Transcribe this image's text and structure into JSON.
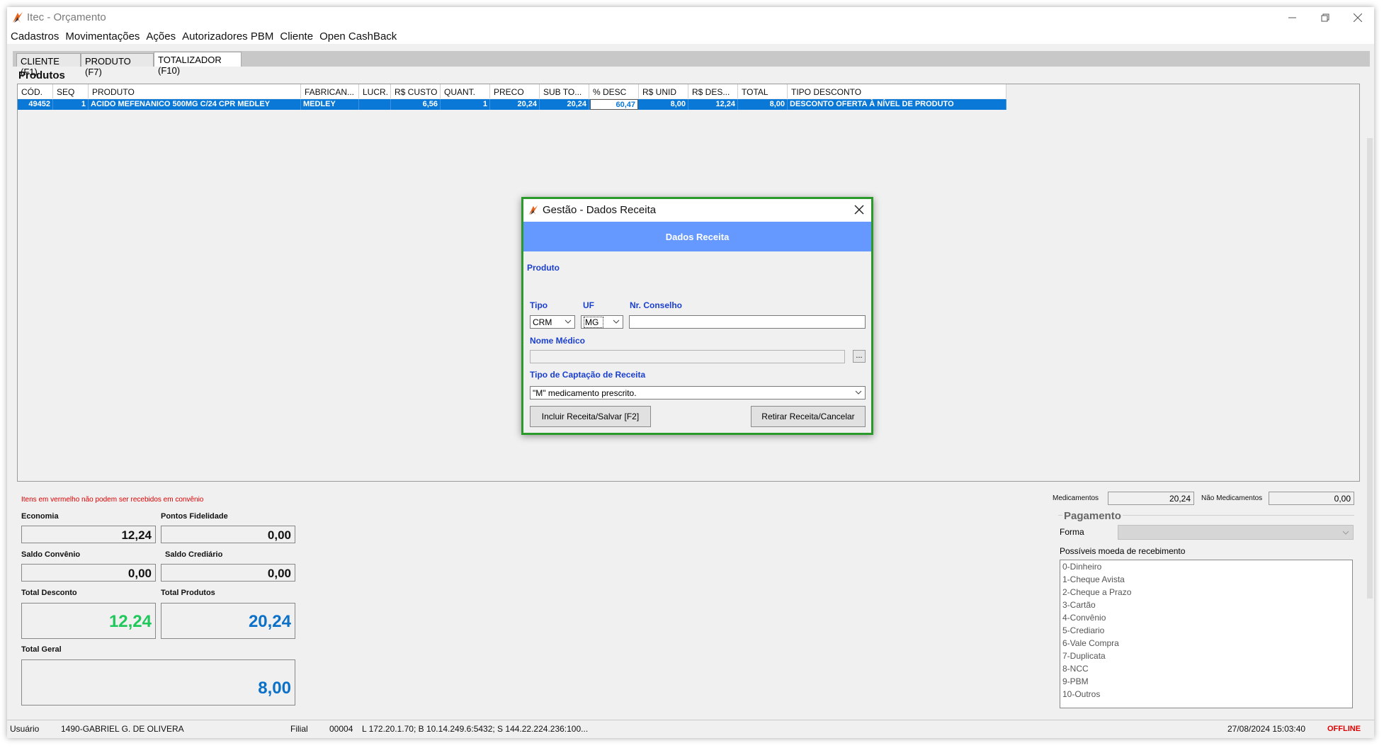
{
  "window": {
    "title": "Itec - Orçamento"
  },
  "menu": [
    "Cadastros",
    "Movimentações",
    "Ações",
    "Autorizadores PBM",
    "Cliente",
    "Open CashBack"
  ],
  "tabs": [
    "CLIENTE (F1)",
    "PRODUTO (F7)",
    "TOTALIZADOR (F10)"
  ],
  "products": {
    "title": "Produtos",
    "columns": [
      "CÓD.",
      "SEQ",
      "PRODUTO",
      "FABRICAN...",
      "LUCR.",
      "R$ CUSTO",
      "QUANT.",
      "PRECO",
      "SUB TO...",
      "% DESC",
      "R$ UNID",
      "R$ DES...",
      "TOTAL",
      "TIPO DESCONTO"
    ],
    "rows": [
      {
        "cod": "49452",
        "seq": "1",
        "produto": "ACIDO MEFENANICO 500MG C/24 CPR MEDLEY",
        "fabricante": "MEDLEY",
        "lucro": "",
        "custo": "6,56",
        "quant": "1",
        "preco": "20,24",
        "subtotal": "20,24",
        "desc_pct": "60,47",
        "unid": "8,00",
        "desconto": "12,24",
        "total": "8,00",
        "tipo_desconto": "DESCONTO OFERTA À NÍVEL DE PRODUTO"
      }
    ]
  },
  "dialog": {
    "title": "Gestão - Dados Receita",
    "banner": "Dados Receita",
    "produto_label": "Produto",
    "tipo_label": "Tipo",
    "tipo_value": "CRM",
    "uf_label": "UF",
    "uf_value": "MG",
    "conselho_label": "Nr. Conselho",
    "conselho_value": "",
    "medico_label": "Nome Médico",
    "medico_value": "",
    "lookup_label": "...",
    "captacao_label": "Tipo de Captação de Receita",
    "captacao_value": "\"M\" medicamento prescrito.",
    "save_button": "Incluir Receita/Salvar [F2]",
    "cancel_button": "Retirar Receita/Cancelar"
  },
  "summary": {
    "note": "Itens em vermelho não podem ser recebidos em convênio",
    "economia_label": "Economia",
    "economia": "12,24",
    "pontos_label": "Pontos Fidelidade",
    "pontos": "0,00",
    "convenio_label": "Saldo Convênio",
    "convenio": "0,00",
    "crediario_label": "Saldo Crediário",
    "crediario": "0,00",
    "total_desconto_label": "Total Desconto",
    "total_desconto": "12,24",
    "total_produtos_label": "Total Produtos",
    "total_produtos": "20,24",
    "total_geral_label": "Total Geral",
    "total_geral": "8,00"
  },
  "right_panel": {
    "medicamentos_label": "Medicamentos",
    "medicamentos": "20,24",
    "nao_medicamentos_label": "Não Medicamentos",
    "nao_medicamentos": "0,00",
    "pagamento_title": "Pagamento",
    "forma_label": "Forma",
    "moedas_label": "Possíveis moeda de recebimento",
    "moedas": [
      "0-Dinheiro",
      "1-Cheque Avista",
      "2-Cheque a Prazo",
      "3-Cartão",
      "4-Convênio",
      "5-Crediario",
      "6-Vale Compra",
      "7-Duplicata",
      "8-NCC",
      "9-PBM",
      "10-Outros"
    ]
  },
  "status": {
    "usuario_label": "Usuário",
    "usuario": "1490-GABRIEL G. DE OLIVERA",
    "filial_label": "Filial",
    "filial": "00004",
    "conexao": "L 172.20.1.70; B 10.14.249.6:5432; S 144.22.224.236:100...",
    "datetime": "27/08/2024 15:03:40",
    "mode": "OFFLINE"
  },
  "colors": {
    "accent": "#0a78d7",
    "banner": "#6699ff",
    "label_blue": "#1a3fd0",
    "green_total": "#1ec85a",
    "blue_total": "#0a70c8",
    "offline": "#e00000"
  }
}
